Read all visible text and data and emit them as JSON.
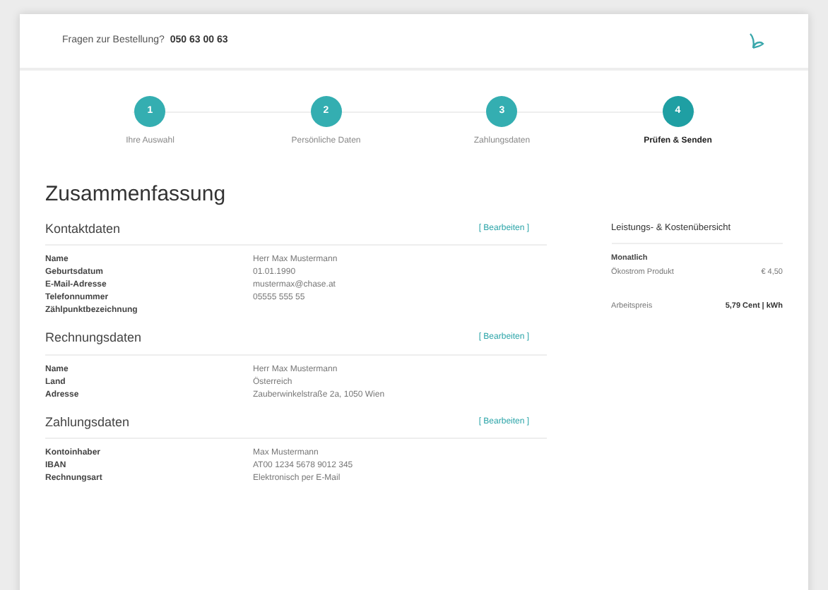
{
  "header": {
    "question": "Fragen zur Bestellung?",
    "phone": "050 63 00 63"
  },
  "steps": [
    {
      "number": "1",
      "label": "Ihre Auswahl",
      "selected": false
    },
    {
      "number": "2",
      "label": "Persönliche Daten",
      "selected": false
    },
    {
      "number": "3",
      "label": "Zahlungsdaten",
      "selected": false
    },
    {
      "number": "4",
      "label": "Prüfen & Senden",
      "selected": true
    }
  ],
  "title": "Zusammenfassung",
  "sections": [
    {
      "heading": "Kontaktdaten",
      "edit_link": "[ Bearbeiten ]",
      "rows": [
        {
          "label": "Name",
          "value": "Herr Max Mustermann"
        },
        {
          "label": "Geburtsdatum",
          "value": "01.01.1990"
        },
        {
          "label": "E-Mail-Adresse",
          "value": "mustermax@chase.at"
        },
        {
          "label": "Telefonnummer",
          "value": "05555 555 55"
        },
        {
          "label": "Zählpunktbezeichnung",
          "value": ""
        }
      ]
    },
    {
      "heading": "Rechnungsdaten",
      "edit_link": "[ Bearbeiten ]",
      "rows": [
        {
          "label": "Name",
          "value": "Herr Max Mustermann"
        },
        {
          "label": "Land",
          "value": "Österreich"
        },
        {
          "label": "Adresse",
          "value": "Zauberwinkelstraße 2a, 1050 Wien"
        }
      ]
    },
    {
      "heading": "Zahlungsdaten",
      "edit_link": "[ Bearbeiten ]",
      "rows": [
        {
          "label": "Kontoinhaber",
          "value": "Max Mustermann"
        },
        {
          "label": "IBAN",
          "value": "AT00 1234 5678 9012 345"
        },
        {
          "label": "Rechnungsart",
          "value": "Elektronisch per E-Mail"
        }
      ]
    }
  ],
  "summary": {
    "title": "Leistungs- & Kostenübersicht",
    "period": "Monatlich",
    "lines": [
      {
        "label": "Ökostrom Produkt",
        "value": "€ 4,50"
      },
      {
        "label": "Arbeitspreis",
        "value": "5,79 Cent | kWh"
      }
    ]
  }
}
